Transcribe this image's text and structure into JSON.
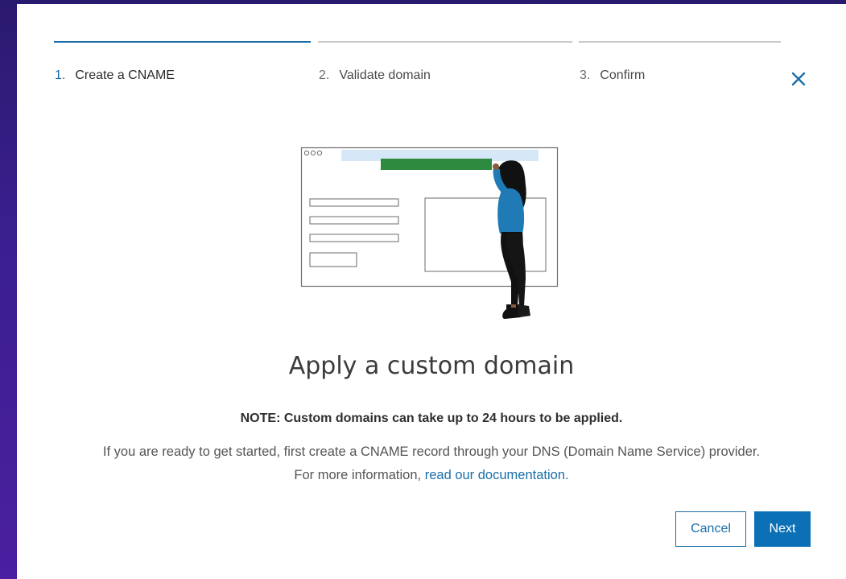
{
  "steps": [
    {
      "num": "1.",
      "label": "Create a CNAME",
      "active": true
    },
    {
      "num": "2.",
      "label": "Validate domain",
      "active": false
    },
    {
      "num": "3.",
      "label": "Confirm",
      "active": false
    }
  ],
  "dialog": {
    "title": "Apply a custom domain",
    "note": "NOTE: Custom domains can take up to 24 hours to be applied.",
    "description_line1": "If you are ready to get started, first create a CNAME record through your DNS (Domain Name Service) provider.",
    "description_prefix": "For more information, ",
    "documentation_link": "read our documentation."
  },
  "buttons": {
    "cancel": "Cancel",
    "next": "Next"
  },
  "icons": {
    "close": "close-icon",
    "illustration": "custom-domain-illustration"
  },
  "colors": {
    "accent": "#1a6fa8",
    "primary_button": "#0b70b5",
    "illustration_green": "#2e8a3e",
    "illustration_blue": "#1f7ab5"
  }
}
